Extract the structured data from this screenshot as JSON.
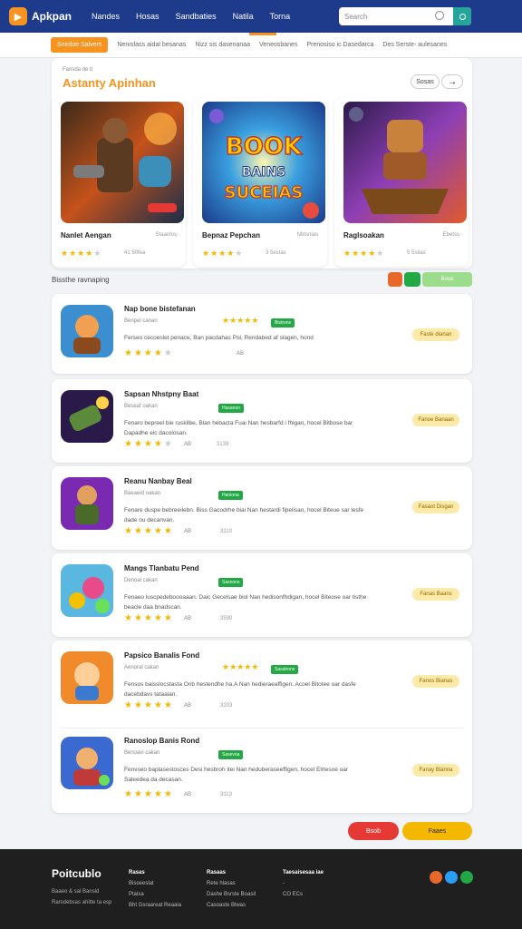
{
  "header": {
    "logo_text": "Apkpan",
    "nav": [
      "Nandes",
      "Hosas",
      "Sandbaties",
      "Natila",
      "Torna"
    ],
    "search_placeholder": "Search"
  },
  "subnav": {
    "active_pill": "Snirdoe Salvers",
    "links": [
      "Nenisfass aidal besanas",
      "Nizz sis dasenanaa",
      "Veneosbanes",
      "Prenosiso ic Dasedarca",
      "Des Serste- aulesanes"
    ]
  },
  "featured": {
    "eyebrow": "Fansda de ti",
    "title": "Astanty Apinhan",
    "more_label": "Sosas",
    "arrow": "→",
    "cards": [
      {
        "name": "Nanlet Aengan",
        "meta": "Staanlos",
        "rating": 4,
        "count": "41 50fea"
      },
      {
        "name": "Bepnaz Pepchan",
        "meta": "Nbtsnias",
        "rating": 4,
        "count": "3 5estas"
      },
      {
        "name": "Raglsoakan",
        "meta": "Ebetss",
        "rating": 4,
        "count": "5 5stias"
      }
    ]
  },
  "list_section": {
    "title": "Bissthe ravnaping",
    "buttons": [
      "",
      "",
      "Bosa"
    ]
  },
  "apps": [
    {
      "title": "Nap bone bistefanan",
      "dev": "Benpei canan",
      "stars": 5,
      "badge": "Bistrons",
      "desc": "Ferseo cecoeslet penace, Ban pacdahas Pol, Rendabed af slagen, hond",
      "rating": 4,
      "rnum": "AB",
      "meta": "",
      "action": "Faste dianan"
    },
    {
      "title": "Sapsan Nhstpny Baat",
      "dev": "Beseaf oakan",
      "stars": 0,
      "badge": "Hasanon",
      "desc": "Fenaro bepreel bie ruskilbe, Blan hebacta Fuai Nan hesbarfd i fhigan, hocel Bitbose bar Dapadhe eic dacolosan.",
      "rating": 4,
      "rnum": "AB",
      "meta": "3139",
      "action": "Fanoe Banaan"
    },
    {
      "title": "Reanu Nanbay Beal",
      "dev": "Baeaeid oakan",
      "stars": 0,
      "badge": "Haniona",
      "desc": "Fenare duspe bebreeilebn. Biss Gacodrhe biai Nan hestardi fipelisan, hocel Biteue sar lesfe dade ou decanvan.",
      "rating": 5,
      "rnum": "AB",
      "meta": "3110",
      "action": "Fasaot Disgan"
    },
    {
      "title": "Mangs Tlanbatu Pend",
      "dev": "Denoal cakan",
      "stars": 0,
      "badge": "Sasnons",
      "desc": "Fenaeo luscpedeboooaaan. Daic Gecelsae biol Nan hedisonfhdigan, hocel Biteose oar tisthe beacle daa bnadscan.",
      "rating": 5,
      "rnum": "AB",
      "meta": "3590",
      "action": "Fanas Baans"
    },
    {
      "title": "Papsico Banalis Fond",
      "dev": "Aenoral cakan",
      "stars": 5,
      "badge": "Sasstrons",
      "desc": "Fensos baisslocstasta Onb hestendhe ha.A Nan hedieraeaffigen. Acoel Bitotee oar dasfe dacebdavs tataaian.",
      "rating": 5,
      "rnum": "AB",
      "meta": "3103",
      "action": "Fanos Bianas"
    },
    {
      "title": "Ranoslop Banis Rond",
      "dev": "Benoavi cakan",
      "stars": 0,
      "badge": "Sasevoa",
      "desc": "Fenvseo baplasestosces Desi hesbroh itei Nan heduberaseeffigen, hocel Elrtesoe oar Saleedea da decasan.",
      "rating": 5,
      "rnum": "AB",
      "meta": "3113",
      "action": "Fanay Bianna"
    }
  ],
  "bottom_buttons": [
    "Bsob",
    "Faaes"
  ],
  "footer": {
    "logo": "Poitcublo",
    "sub": [
      "Baaeo & sal Bansid",
      "Rarsdebsas ahitte ta esp"
    ],
    "col1": {
      "head": "Rasas",
      "items": [
        "Bisoeeslat",
        "Ptaisa",
        "Bht Gsraareat Reaaia"
      ]
    },
    "col2": {
      "head": "Rasaas",
      "items": [
        "Rete hlasas",
        "Dashe Bsrste Boasil",
        "Casoaste Blwas"
      ]
    },
    "col3": {
      "head": "Taesaisesaa iae",
      "items": [
        "-",
        "CO ECs"
      ]
    }
  },
  "colors": {
    "primary": "#1e3a8a",
    "accent": "#f7931e",
    "teal": "#26a69a",
    "green": "#22a845"
  }
}
